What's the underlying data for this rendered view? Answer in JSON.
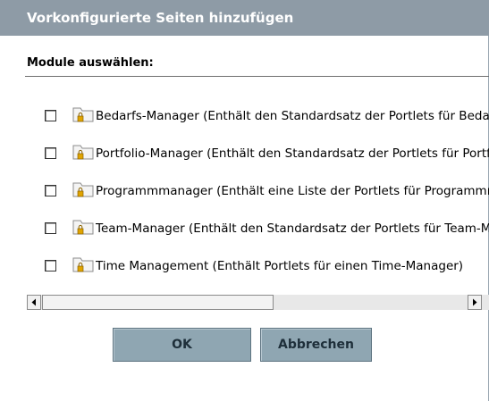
{
  "dialog": {
    "title": "Vorkonfigurierte Seiten hinzufügen",
    "section_label": "Module auswählen:"
  },
  "modules": [
    {
      "label": "Bedarfs-Manager (Enthält den Standardsatz der Portlets für Bedarfs-Manager)",
      "checked": false,
      "icon": "locked-folder-icon"
    },
    {
      "label": "Portfolio-Manager (Enthält den Standardsatz der Portlets für Portfolio-Manager)",
      "checked": false,
      "icon": "locked-folder-icon"
    },
    {
      "label": "Programmmanager (Enthält eine Liste der Portlets für Programmmanager)",
      "checked": false,
      "icon": "locked-folder-icon"
    },
    {
      "label": "Team-Manager (Enthält den Standardsatz der Portlets für Team-Manager)",
      "checked": false,
      "icon": "locked-folder-icon"
    },
    {
      "label": "Time Management (Enthält Portlets für einen Time-Manager)",
      "checked": false,
      "icon": "locked-folder-icon"
    }
  ],
  "buttons": {
    "ok_label": "OK",
    "cancel_label": "Abbrechen"
  },
  "colors": {
    "titlebar": "#8e9ba6",
    "button": "#8fa6b2"
  }
}
